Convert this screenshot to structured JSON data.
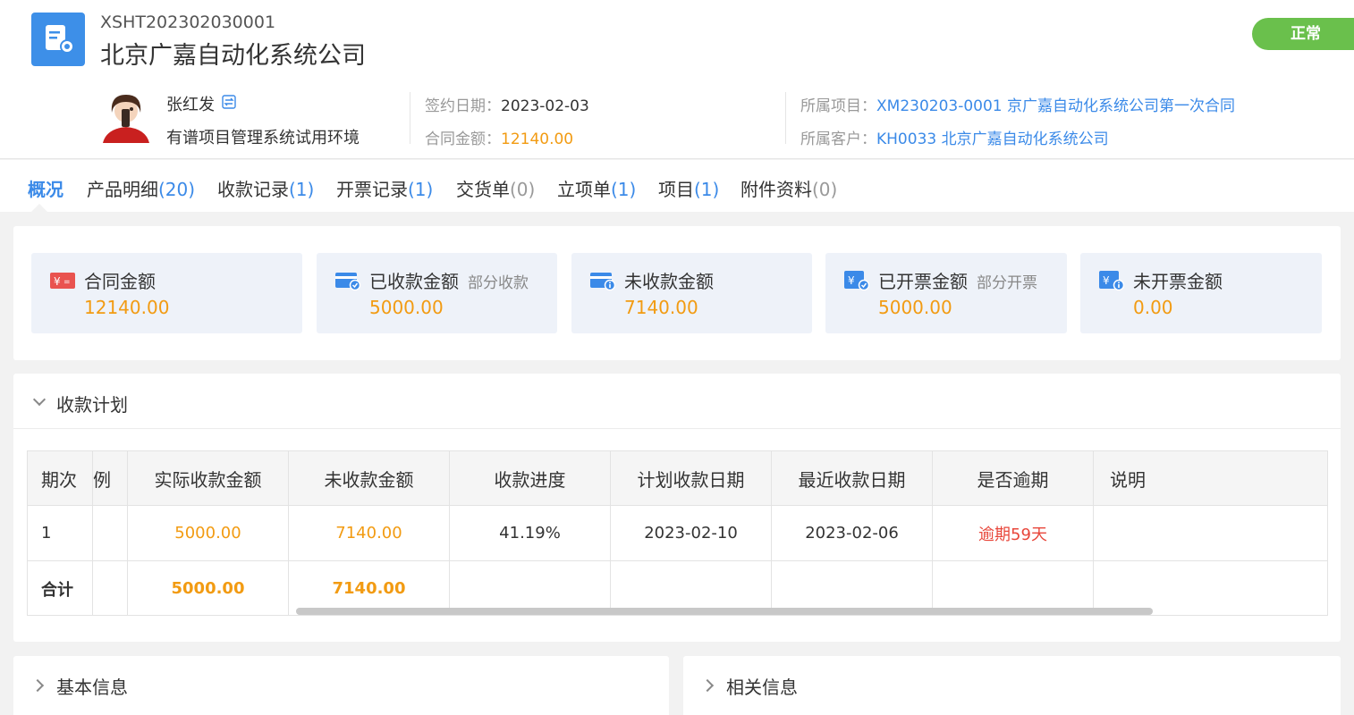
{
  "header": {
    "contract_no": "XSHT202302030001",
    "title": "北京广嘉自动化系统公司",
    "status": "正常",
    "owner_name": "张红发",
    "org_name": "有谱项目管理系统试用环境",
    "sign_date_label": "签约日期：",
    "sign_date": "2023-02-03",
    "amount_label": "合同金额：",
    "amount": "12140.00",
    "project_label": "所属项目：",
    "project": "XM230203-0001 京广嘉自动化系统公司第一次合同",
    "customer_label": "所属客户：",
    "customer": "KH0033 北京广嘉自动化系统公司"
  },
  "tabs": [
    {
      "label": "概况",
      "count": ""
    },
    {
      "label": "产品明细",
      "count": "(20)"
    },
    {
      "label": "收款记录",
      "count": "(1)"
    },
    {
      "label": "开票记录",
      "count": "(1)"
    },
    {
      "label": "交货单",
      "count": "(0)"
    },
    {
      "label": "立项单",
      "count": "(1)"
    },
    {
      "label": "项目",
      "count": "(1)"
    },
    {
      "label": "附件资料",
      "count": "(0)"
    }
  ],
  "summary": {
    "contract_amount": {
      "label": "合同金额",
      "value": "12140.00"
    },
    "received": {
      "label": "已收款金额",
      "sub": "部分收款",
      "value": "5000.00"
    },
    "unreceived": {
      "label": "未收款金额",
      "value": "7140.00"
    },
    "invoiced": {
      "label": "已开票金额",
      "sub": "部分开票",
      "value": "5000.00"
    },
    "uninvoiced": {
      "label": "未开票金额",
      "value": "0.00"
    }
  },
  "plan": {
    "title": "收款计划",
    "columns": [
      "期次",
      "例",
      "实际收款金额",
      "未收款金额",
      "收款进度",
      "计划收款日期",
      "最近收款日期",
      "是否逾期",
      "说明"
    ],
    "row": {
      "period": "1",
      "partial": "",
      "actual": "5000.00",
      "unreceived": "7140.00",
      "progress": "41.19%",
      "plan_date": "2023-02-10",
      "last_date": "2023-02-06",
      "overdue": "逾期59天",
      "note": ""
    },
    "total": {
      "label": "合计",
      "actual": "5000.00",
      "unreceived": "7140.00"
    }
  },
  "sections": {
    "basic": "基本信息",
    "related": "相关信息"
  },
  "colors": {
    "accent": "#3b8ae8",
    "amount": "#f29b12",
    "status": "#6ac04c",
    "overdue": "#e8473b"
  }
}
